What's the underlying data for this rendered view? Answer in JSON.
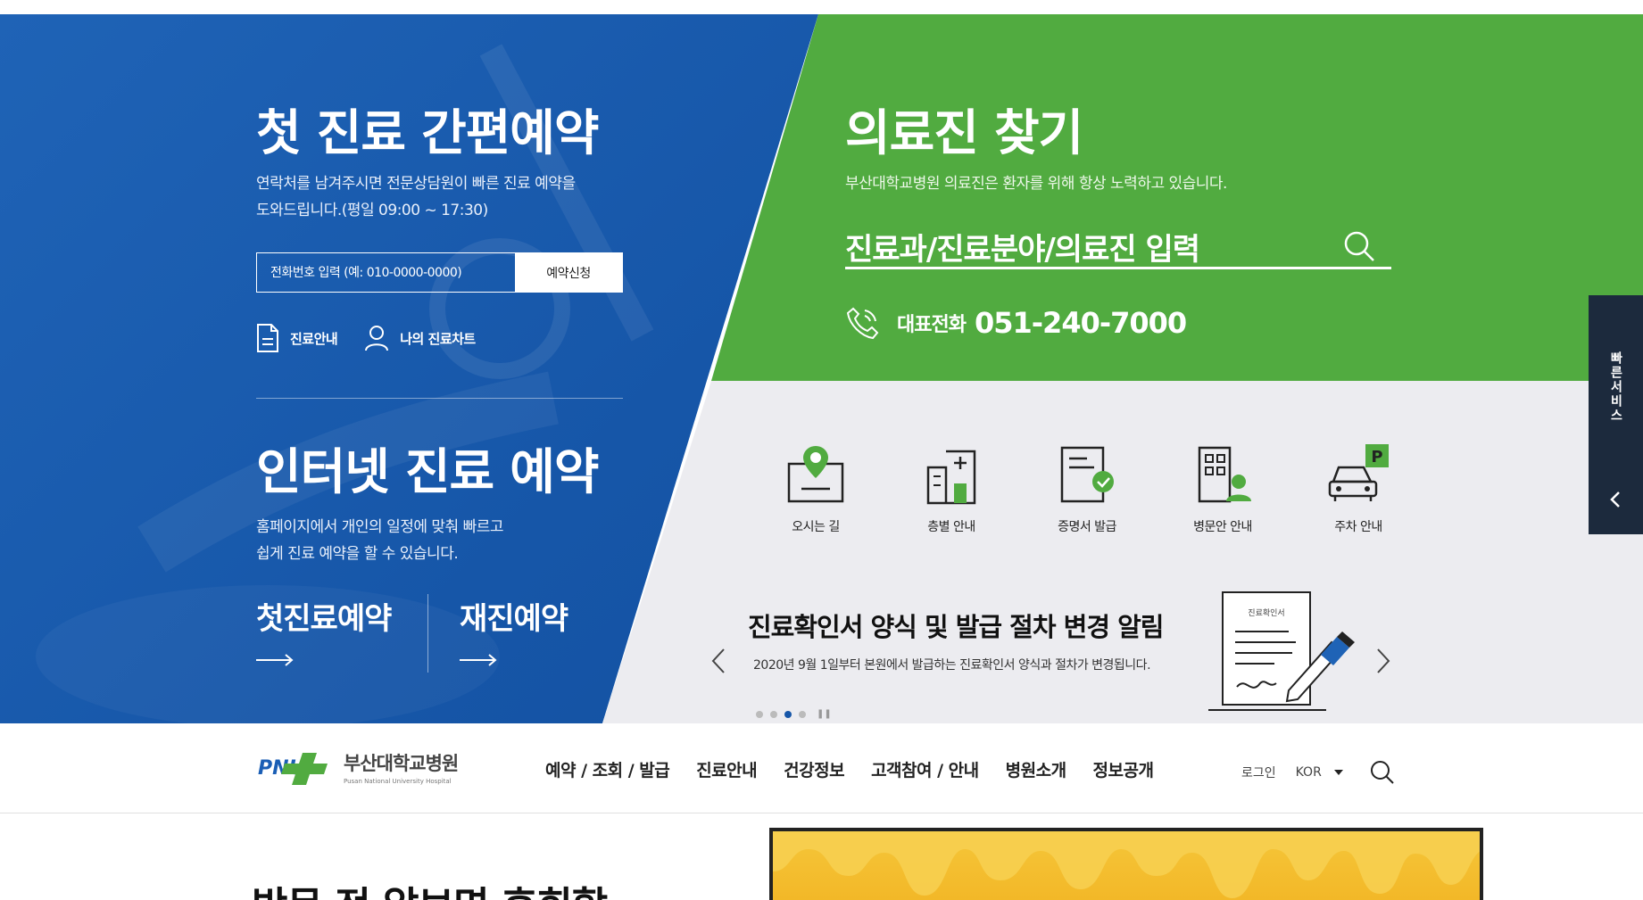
{
  "hero_left": {
    "title": "첫 진료 간편예약",
    "desc_line1": "연락처를 남겨주시면 전문상담원이 빠른 진료 예약을",
    "desc_line2": "도와드립니다.(평일 09:00 ~ 17:30)",
    "phone_placeholder": "전화번호 입력 (예: 010-0000-0000)",
    "reserve_button": "예약신청",
    "link_guide": "진료안내",
    "link_chart": "나의 진료차트",
    "title2": "인터넷 진료 예약",
    "desc2_line1": "홈페이지에서 개인의 일정에 맞춰 빠르고",
    "desc2_line2": "쉽게 진료 예약을 할 수 있습니다.",
    "first_visit": "첫진료예약",
    "revisit": "재진예약"
  },
  "hero_right": {
    "title": "의료진 찾기",
    "desc": "부산대학교병원 의료진은 환자를 위해 항상 노력하고 있습니다.",
    "search_placeholder": "진료과/진료분야/의료진 입력",
    "tel_label": "대표전화",
    "tel_number": "051-240-7000"
  },
  "services": [
    {
      "label": "오시는 길",
      "icon": "location-map-icon"
    },
    {
      "label": "층별 안내",
      "icon": "building-floor-icon"
    },
    {
      "label": "증명서 발급",
      "icon": "certificate-icon"
    },
    {
      "label": "병문안 안내",
      "icon": "visit-building-icon"
    },
    {
      "label": "주차 안내",
      "icon": "parking-car-icon"
    }
  ],
  "notice": {
    "title": "진료확인서 양식 및 발급 절차 변경 알림",
    "desc": "2020년 9월 1일부터 본원에서 발급하는 진료확인서 양식과 절차가 변경됩니다.",
    "image_doc_label": "진료확인서",
    "active_dot": 3,
    "dot_count": 4
  },
  "quick_service": {
    "label": "빠른서비스"
  },
  "nav": {
    "logo_mark": "PNU",
    "logo_ko": "부산대학교병원",
    "logo_en": "Pusan National University Hospital",
    "menu": [
      "예약 / 조회 / 발급",
      "진료안내",
      "건강정보",
      "고객참여 / 안내",
      "병원소개",
      "정보공개"
    ],
    "login": "로그인",
    "lang": "KOR"
  },
  "bottom": {
    "heading": "방문 전 알보면 후회할"
  },
  "colors": {
    "blue": "#1656a8",
    "green": "#51ab40",
    "gray": "#ececf0",
    "dark": "#1c2a3d"
  }
}
